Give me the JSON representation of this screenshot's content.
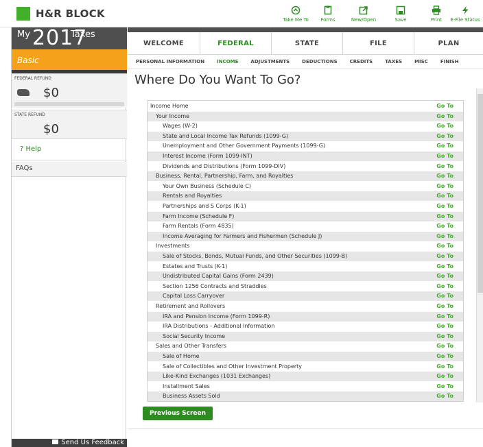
{
  "brand": {
    "name": "H&R BLOCK",
    "green": "#43b02a"
  },
  "toolbar": [
    {
      "label": "Take Me To",
      "icon": "arrow-circle-icon"
    },
    {
      "label": "Forms",
      "icon": "document-icon"
    },
    {
      "label": "New/Open",
      "icon": "open-external-icon"
    },
    {
      "label": "Save",
      "icon": "save-icon"
    },
    {
      "label": "Print",
      "icon": "printer-icon"
    },
    {
      "label": "E-File Status",
      "icon": "lightning-icon"
    }
  ],
  "sidebar": {
    "my": "My",
    "year": "2017",
    "taxes": "Taxes",
    "plan": "Basic",
    "federal_label": "FEDERAL REFUND",
    "federal_value": "$0",
    "state_label": "STATE REFUND",
    "state_value": "$0",
    "help": "? Help",
    "faqs": "FAQs",
    "feedback": "Send Us Feedback"
  },
  "tabs": [
    {
      "label": "WELCOME"
    },
    {
      "label": "FEDERAL"
    },
    {
      "label": "STATE"
    },
    {
      "label": "FILE"
    },
    {
      "label": "PLAN"
    }
  ],
  "subtabs": [
    {
      "label": "PERSONAL INFORMATION"
    },
    {
      "label": "INCOME"
    },
    {
      "label": "ADJUSTMENTS"
    },
    {
      "label": "DEDUCTIONS"
    },
    {
      "label": "CREDITS"
    },
    {
      "label": "TAXES"
    },
    {
      "label": "MISC"
    },
    {
      "label": "FINISH"
    }
  ],
  "page_title": "Where Do You Want To Go?",
  "go_label": "Go To",
  "rows": [
    {
      "label": "Income Home",
      "level": 0
    },
    {
      "label": "Your Income",
      "level": 1
    },
    {
      "label": "Wages (W-2)",
      "level": 2
    },
    {
      "label": "State and Local Income Tax Refunds (1099-G)",
      "level": 2
    },
    {
      "label": "Unemployment and Other Government Payments (1099-G)",
      "level": 2
    },
    {
      "label": "Interest Income (Form 1099-INT)",
      "level": 2
    },
    {
      "label": "Dividends and Distributions (Form 1099-DIV)",
      "level": 2
    },
    {
      "label": "Business, Rental, Partnership, Farm, and Royalties",
      "level": 1
    },
    {
      "label": "Your Own Business (Schedule C)",
      "level": 2
    },
    {
      "label": "Rentals and Royalties",
      "level": 2
    },
    {
      "label": "Partnerships and S Corps (K-1)",
      "level": 2
    },
    {
      "label": "Farm Income (Schedule F)",
      "level": 2
    },
    {
      "label": "Farm Rentals (Form 4835)",
      "level": 2
    },
    {
      "label": "Income Averaging for Farmers and Fishermen (Schedule J)",
      "level": 2
    },
    {
      "label": "Investments",
      "level": 1
    },
    {
      "label": "Sale of Stocks, Bonds, Mutual Funds, and Other Securities (1099-B)",
      "level": 2
    },
    {
      "label": "Estates and Trusts (K-1)",
      "level": 2
    },
    {
      "label": "Undistributed Capital Gains (Form 2439)",
      "level": 2
    },
    {
      "label": "Section 1256 Contracts and Straddles",
      "level": 2
    },
    {
      "label": "Capital Loss Carryover",
      "level": 2
    },
    {
      "label": "Retirement and Rollovers",
      "level": 1
    },
    {
      "label": "IRA and Pension Income (Form 1099-R)",
      "level": 2
    },
    {
      "label": "IRA Distributions - Additional Information",
      "level": 2
    },
    {
      "label": "Social Security Income",
      "level": 2
    },
    {
      "label": "Sales and Other Transfers",
      "level": 1
    },
    {
      "label": "Sale of Home",
      "level": 2
    },
    {
      "label": "Sale of Collectibles and Other Investment Property",
      "level": 2
    },
    {
      "label": "Like-Kind Exchanges (1031 Exchanges)",
      "level": 2
    },
    {
      "label": "Installment Sales",
      "level": 2
    },
    {
      "label": "Business Assets Sold",
      "level": 2
    }
  ],
  "prev_button": "Previous Screen"
}
